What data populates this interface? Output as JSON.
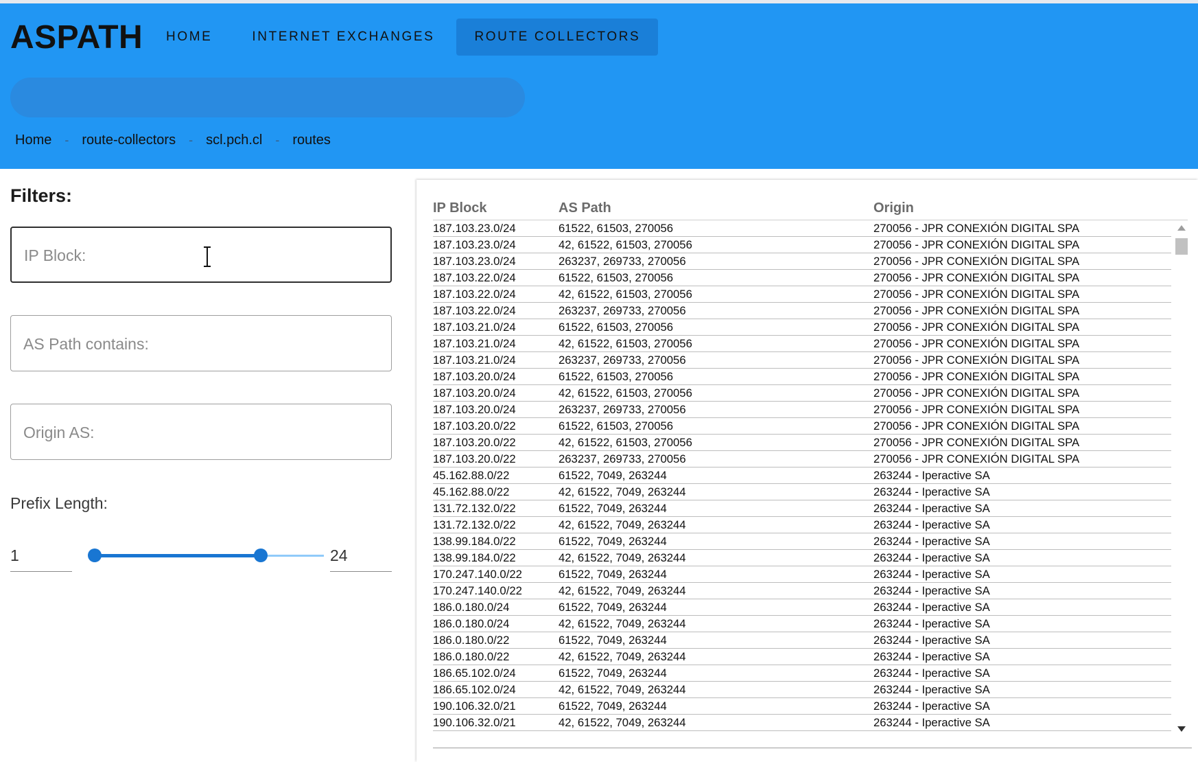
{
  "app": {
    "logo": "ASPATH"
  },
  "nav": {
    "items": [
      {
        "label": "HOME"
      },
      {
        "label": "INTERNET EXCHANGES"
      },
      {
        "label": "ROUTE COLLECTORS"
      }
    ],
    "active": "ROUTE COLLECTORS"
  },
  "search": {
    "placeholder": ""
  },
  "breadcrumb": {
    "items": [
      "Home",
      "route-collectors",
      "scl.pch.cl",
      "routes"
    ],
    "separator": "-"
  },
  "filters": {
    "title": "Filters:",
    "ip_block_placeholder": "IP Block:",
    "as_path_placeholder": "AS Path contains:",
    "origin_as_placeholder": "Origin AS:",
    "prefix_length_label": "Prefix Length:",
    "prefix_min": "1",
    "prefix_max": "24",
    "slider": {
      "min": 1,
      "max": 32,
      "low": 1,
      "high": 24
    }
  },
  "table": {
    "headers": {
      "ip_block": "IP Block",
      "as_path": "AS Path",
      "origin": "Origin"
    },
    "rows": [
      [
        "187.103.23.0/24",
        "61522, 61503, 270056",
        "270056 - JPR CONEXIÓN DIGITAL SPA"
      ],
      [
        "187.103.23.0/24",
        "42, 61522, 61503, 270056",
        "270056 - JPR CONEXIÓN DIGITAL SPA"
      ],
      [
        "187.103.23.0/24",
        "263237, 269733, 270056",
        "270056 - JPR CONEXIÓN DIGITAL SPA"
      ],
      [
        "187.103.22.0/24",
        "61522, 61503, 270056",
        "270056 - JPR CONEXIÓN DIGITAL SPA"
      ],
      [
        "187.103.22.0/24",
        "42, 61522, 61503, 270056",
        "270056 - JPR CONEXIÓN DIGITAL SPA"
      ],
      [
        "187.103.22.0/24",
        "263237, 269733, 270056",
        "270056 - JPR CONEXIÓN DIGITAL SPA"
      ],
      [
        "187.103.21.0/24",
        "61522, 61503, 270056",
        "270056 - JPR CONEXIÓN DIGITAL SPA"
      ],
      [
        "187.103.21.0/24",
        "42, 61522, 61503, 270056",
        "270056 - JPR CONEXIÓN DIGITAL SPA"
      ],
      [
        "187.103.21.0/24",
        "263237, 269733, 270056",
        "270056 - JPR CONEXIÓN DIGITAL SPA"
      ],
      [
        "187.103.20.0/24",
        "61522, 61503, 270056",
        "270056 - JPR CONEXIÓN DIGITAL SPA"
      ],
      [
        "187.103.20.0/24",
        "42, 61522, 61503, 270056",
        "270056 - JPR CONEXIÓN DIGITAL SPA"
      ],
      [
        "187.103.20.0/24",
        "263237, 269733, 270056",
        "270056 - JPR CONEXIÓN DIGITAL SPA"
      ],
      [
        "187.103.20.0/22",
        "61522, 61503, 270056",
        "270056 - JPR CONEXIÓN DIGITAL SPA"
      ],
      [
        "187.103.20.0/22",
        "42, 61522, 61503, 270056",
        "270056 - JPR CONEXIÓN DIGITAL SPA"
      ],
      [
        "187.103.20.0/22",
        "263237, 269733, 270056",
        "270056 - JPR CONEXIÓN DIGITAL SPA"
      ],
      [
        "45.162.88.0/22",
        "61522, 7049, 263244",
        "263244 - Iperactive SA"
      ],
      [
        "45.162.88.0/22",
        "42, 61522, 7049, 263244",
        "263244 - Iperactive SA"
      ],
      [
        "131.72.132.0/22",
        "61522, 7049, 263244",
        "263244 - Iperactive SA"
      ],
      [
        "131.72.132.0/22",
        "42, 61522, 7049, 263244",
        "263244 - Iperactive SA"
      ],
      [
        "138.99.184.0/22",
        "61522, 7049, 263244",
        "263244 - Iperactive SA"
      ],
      [
        "138.99.184.0/22",
        "42, 61522, 7049, 263244",
        "263244 - Iperactive SA"
      ],
      [
        "170.247.140.0/22",
        "61522, 7049, 263244",
        "263244 - Iperactive SA"
      ],
      [
        "170.247.140.0/22",
        "42, 61522, 7049, 263244",
        "263244 - Iperactive SA"
      ],
      [
        "186.0.180.0/24",
        "61522, 7049, 263244",
        "263244 - Iperactive SA"
      ],
      [
        "186.0.180.0/24",
        "42, 61522, 7049, 263244",
        "263244 - Iperactive SA"
      ],
      [
        "186.0.180.0/22",
        "61522, 7049, 263244",
        "263244 - Iperactive SA"
      ],
      [
        "186.0.180.0/22",
        "42, 61522, 7049, 263244",
        "263244 - Iperactive SA"
      ],
      [
        "186.65.102.0/24",
        "61522, 7049, 263244",
        "263244 - Iperactive SA"
      ],
      [
        "186.65.102.0/24",
        "42, 61522, 7049, 263244",
        "263244 - Iperactive SA"
      ],
      [
        "190.106.32.0/21",
        "61522, 7049, 263244",
        "263244 - Iperactive SA"
      ],
      [
        "190.106.32.0/21",
        "42, 61522, 7049, 263244",
        "263244 - Iperactive SA"
      ]
    ]
  },
  "colors": {
    "header_bg": "#2196f3",
    "nav_active_bg": "#1a7fd8",
    "search_bg": "#2a8ae0",
    "slider_accent": "#1976d2",
    "slider_rail": "#90caf9"
  }
}
